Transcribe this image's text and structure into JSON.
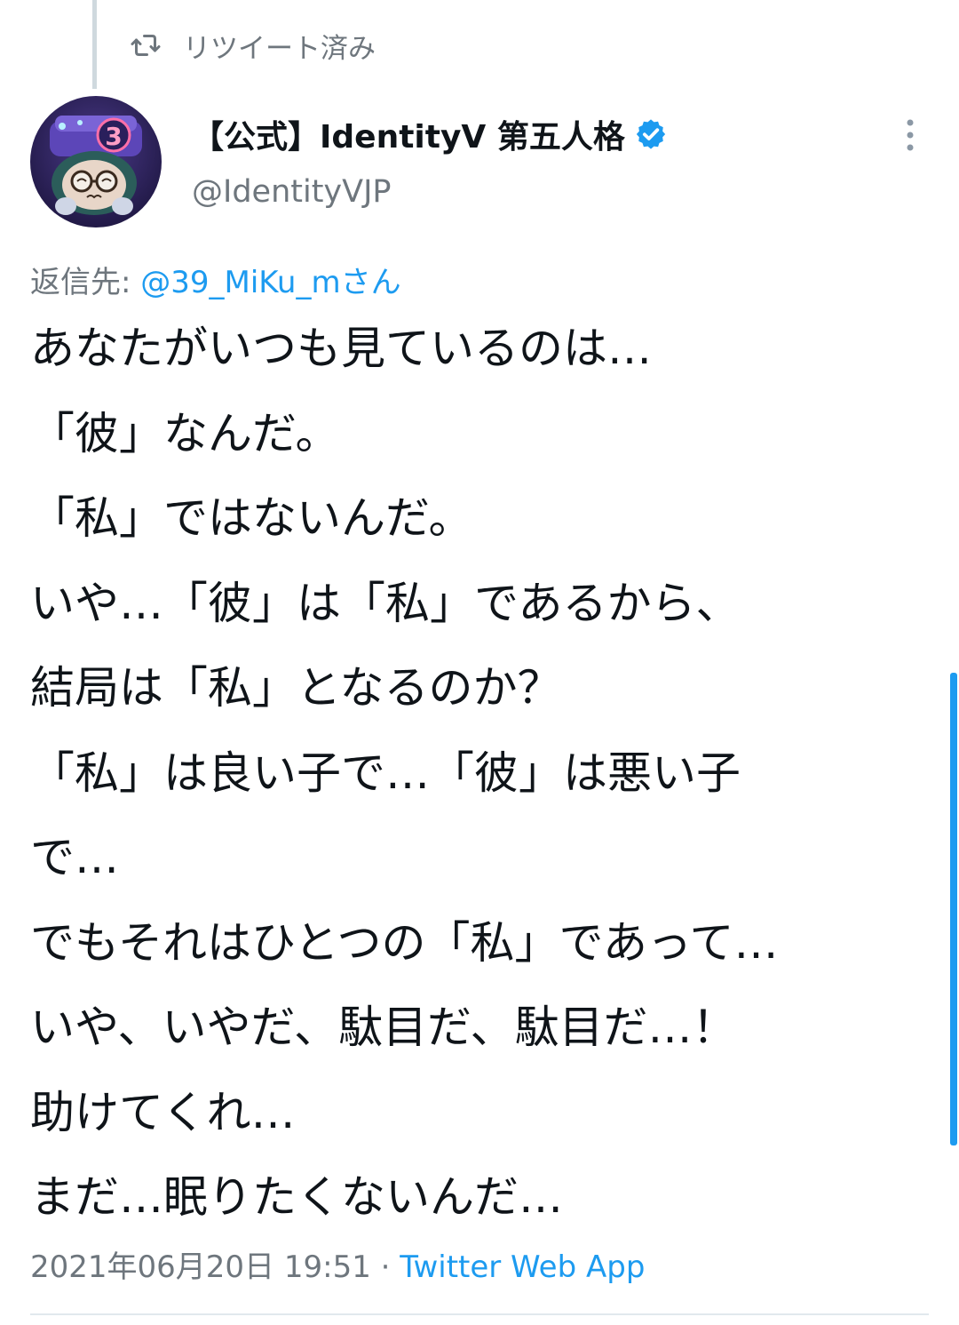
{
  "retweet": {
    "label": "リツイート済み"
  },
  "author": {
    "display_name": "【公式】IdentityV 第五人格",
    "handle": "@IdentityVJP",
    "verified": true,
    "avatar_badge": "3"
  },
  "reply": {
    "prefix": "返信先: ",
    "mention": "@39_MiKu_mさん"
  },
  "tweet": {
    "lines": [
      "あなたがいつも見ているのは…",
      "「彼」なんだ。",
      "「私」ではないんだ。",
      "いや…「彼」は「私」であるから、",
      "結局は「私」となるのか？",
      "「私」は良い子で…「彼」は悪い子",
      "で…",
      "でもそれはひとつの「私」であって…",
      "いや、いやだ、駄目だ、駄目だ…！",
      "助けてくれ…",
      "まだ…眠りたくないんだ…"
    ]
  },
  "meta": {
    "timestamp": "2021年06月20日 19:51",
    "separator": " · ",
    "source": "Twitter Web App"
  },
  "icons": {
    "retweet": "retweet-icon",
    "verified": "verified-badge-icon",
    "more": "more-vertical-icon"
  },
  "colors": {
    "accent": "#1d9bf0",
    "secondary_text": "#6e767d",
    "primary_text": "#0f1419"
  }
}
